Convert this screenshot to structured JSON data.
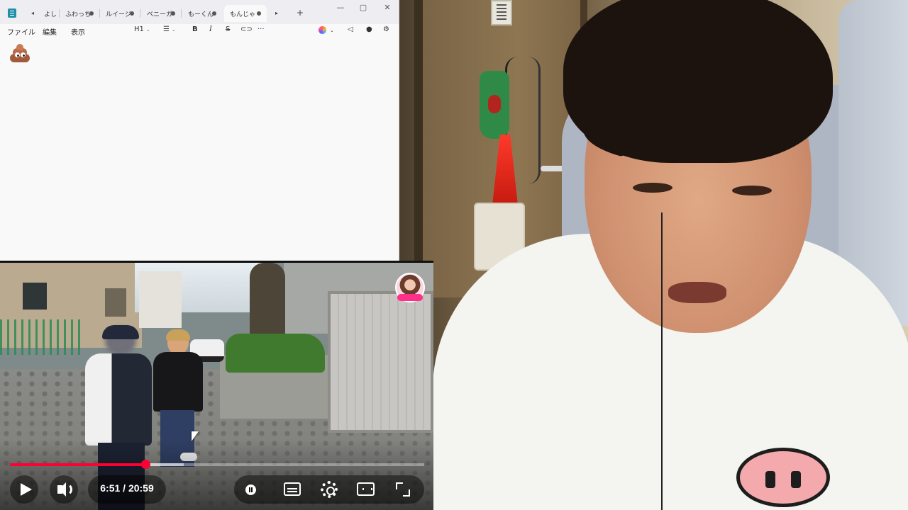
{
  "notepad": {
    "tabs": [
      {
        "label": "よし",
        "active": false
      },
      {
        "label": "ふわっち",
        "active": false
      },
      {
        "label": "ルイージ",
        "active": false
      },
      {
        "label": "ベニーガ",
        "active": false
      },
      {
        "label": "もーくん",
        "active": false
      },
      {
        "label": "もんじゃ",
        "active": true
      }
    ],
    "menu": [
      "ファイル",
      "編集",
      "表示"
    ],
    "toolbar": {
      "heading": "H1",
      "bold": "B",
      "italic": "I",
      "strike": "S",
      "more": "···"
    },
    "window_controls": {
      "minimize": "—",
      "maximize": "▢",
      "close": "✕"
    },
    "new_tab": "+",
    "tab_left": "◂",
    "tab_right": "▸",
    "content_emoji": "poop-emoji-icon"
  },
  "video": {
    "current_time": "6:51",
    "duration": "20:59",
    "time_display": "6:51 / 20:59",
    "progress_fraction": 0.327,
    "buffered_fraction": 0.42,
    "accent_color": "#ff0033"
  }
}
